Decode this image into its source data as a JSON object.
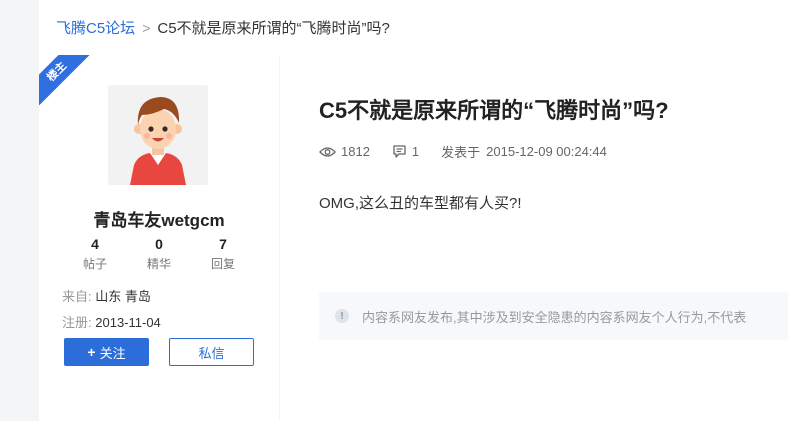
{
  "breadcrumb": {
    "forum_label": "飞腾C5论坛",
    "separator": ">",
    "current_label": "C5不就是原来所谓的“飞腾时尚”吗?"
  },
  "profile": {
    "badge_label": "楼主",
    "username": "青岛车友wetgcm",
    "stats": [
      {
        "value": "4",
        "label": "帖子"
      },
      {
        "value": "0",
        "label": "精华"
      },
      {
        "value": "7",
        "label": "回复"
      }
    ],
    "location_label": "来自:",
    "location_value": "山东 青岛",
    "registered_label": "注册:",
    "registered_value": "2013-11-04",
    "follow_button_label": "关注",
    "message_button_label": "私信"
  },
  "post": {
    "title": "C5不就是原来所谓的“飞腾时尚”吗?",
    "views": "1812",
    "replies": "1",
    "posted_label": "发表于",
    "posted_at": "2015-12-09 00:24:44",
    "body": "OMG,这么丑的车型都有人买?!",
    "notice": "内容系网友发布,其中涉及到安全隐患的内容系网友个人行为,不代表"
  },
  "colors": {
    "accent": "#2b6ed9",
    "badge": "#2f6fe0",
    "page_background": "#f4f5f7"
  }
}
